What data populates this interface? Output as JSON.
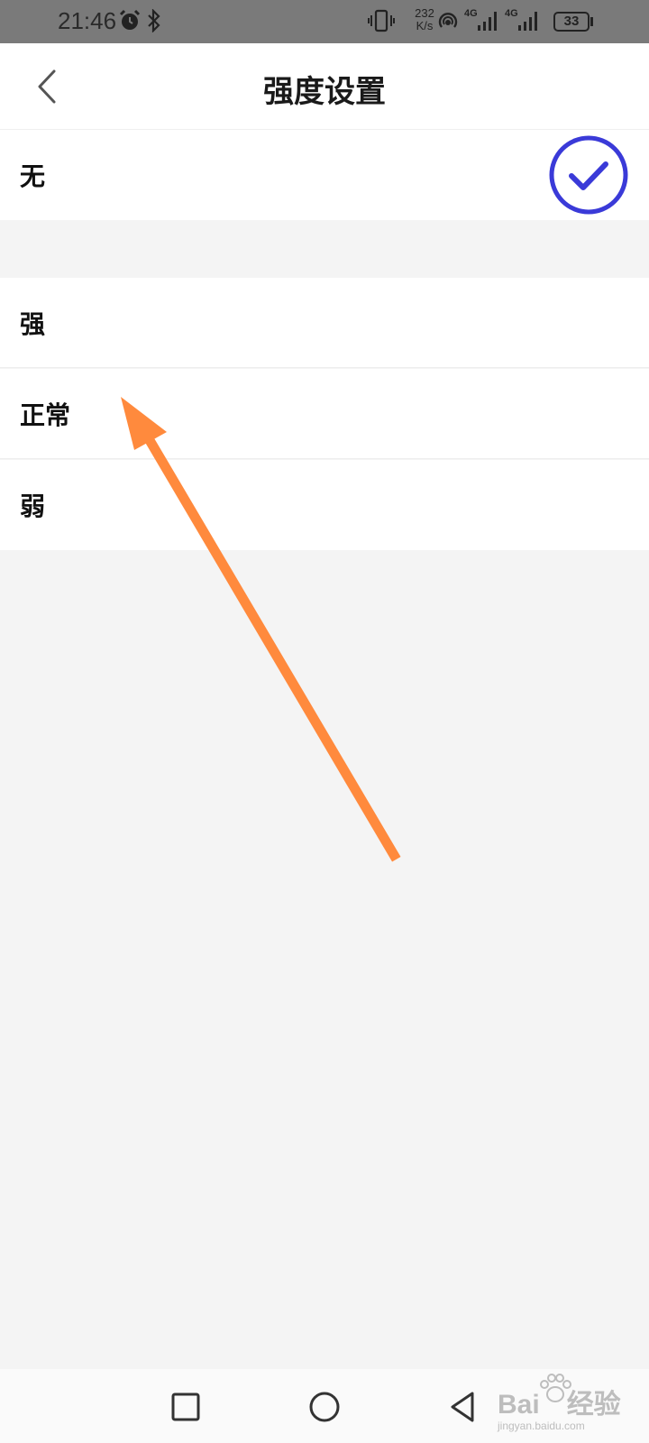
{
  "status_bar": {
    "time": "21:46",
    "net_speed_value": "232",
    "net_speed_unit": "K/s",
    "network_1": "4G",
    "network_2": "4G",
    "battery_level": "33",
    "icons": [
      "alarm-icon",
      "bluetooth-icon",
      "vibrate-icon",
      "hotspot-icon",
      "signal-icon",
      "battery-icon"
    ]
  },
  "header": {
    "title": "强度设置",
    "back_icon": "chevron-left-icon"
  },
  "options_group_1": [
    {
      "label": "无",
      "selected": true
    }
  ],
  "options_group_2": [
    {
      "label": "强",
      "selected": false
    },
    {
      "label": "正常",
      "selected": false
    },
    {
      "label": "弱",
      "selected": false
    }
  ],
  "nav_bar": {
    "icons": [
      "recents-square-icon",
      "home-circle-icon",
      "back-triangle-icon"
    ]
  },
  "watermark": {
    "brand": "Bai",
    "brand_suffix": "经验",
    "site": "jingyan.baidu.com"
  },
  "colors": {
    "accent": "#3a3ad8",
    "arrow": "#ff8a3d",
    "background": "#f4f4f4",
    "status_bar": "#7a7a7a"
  }
}
